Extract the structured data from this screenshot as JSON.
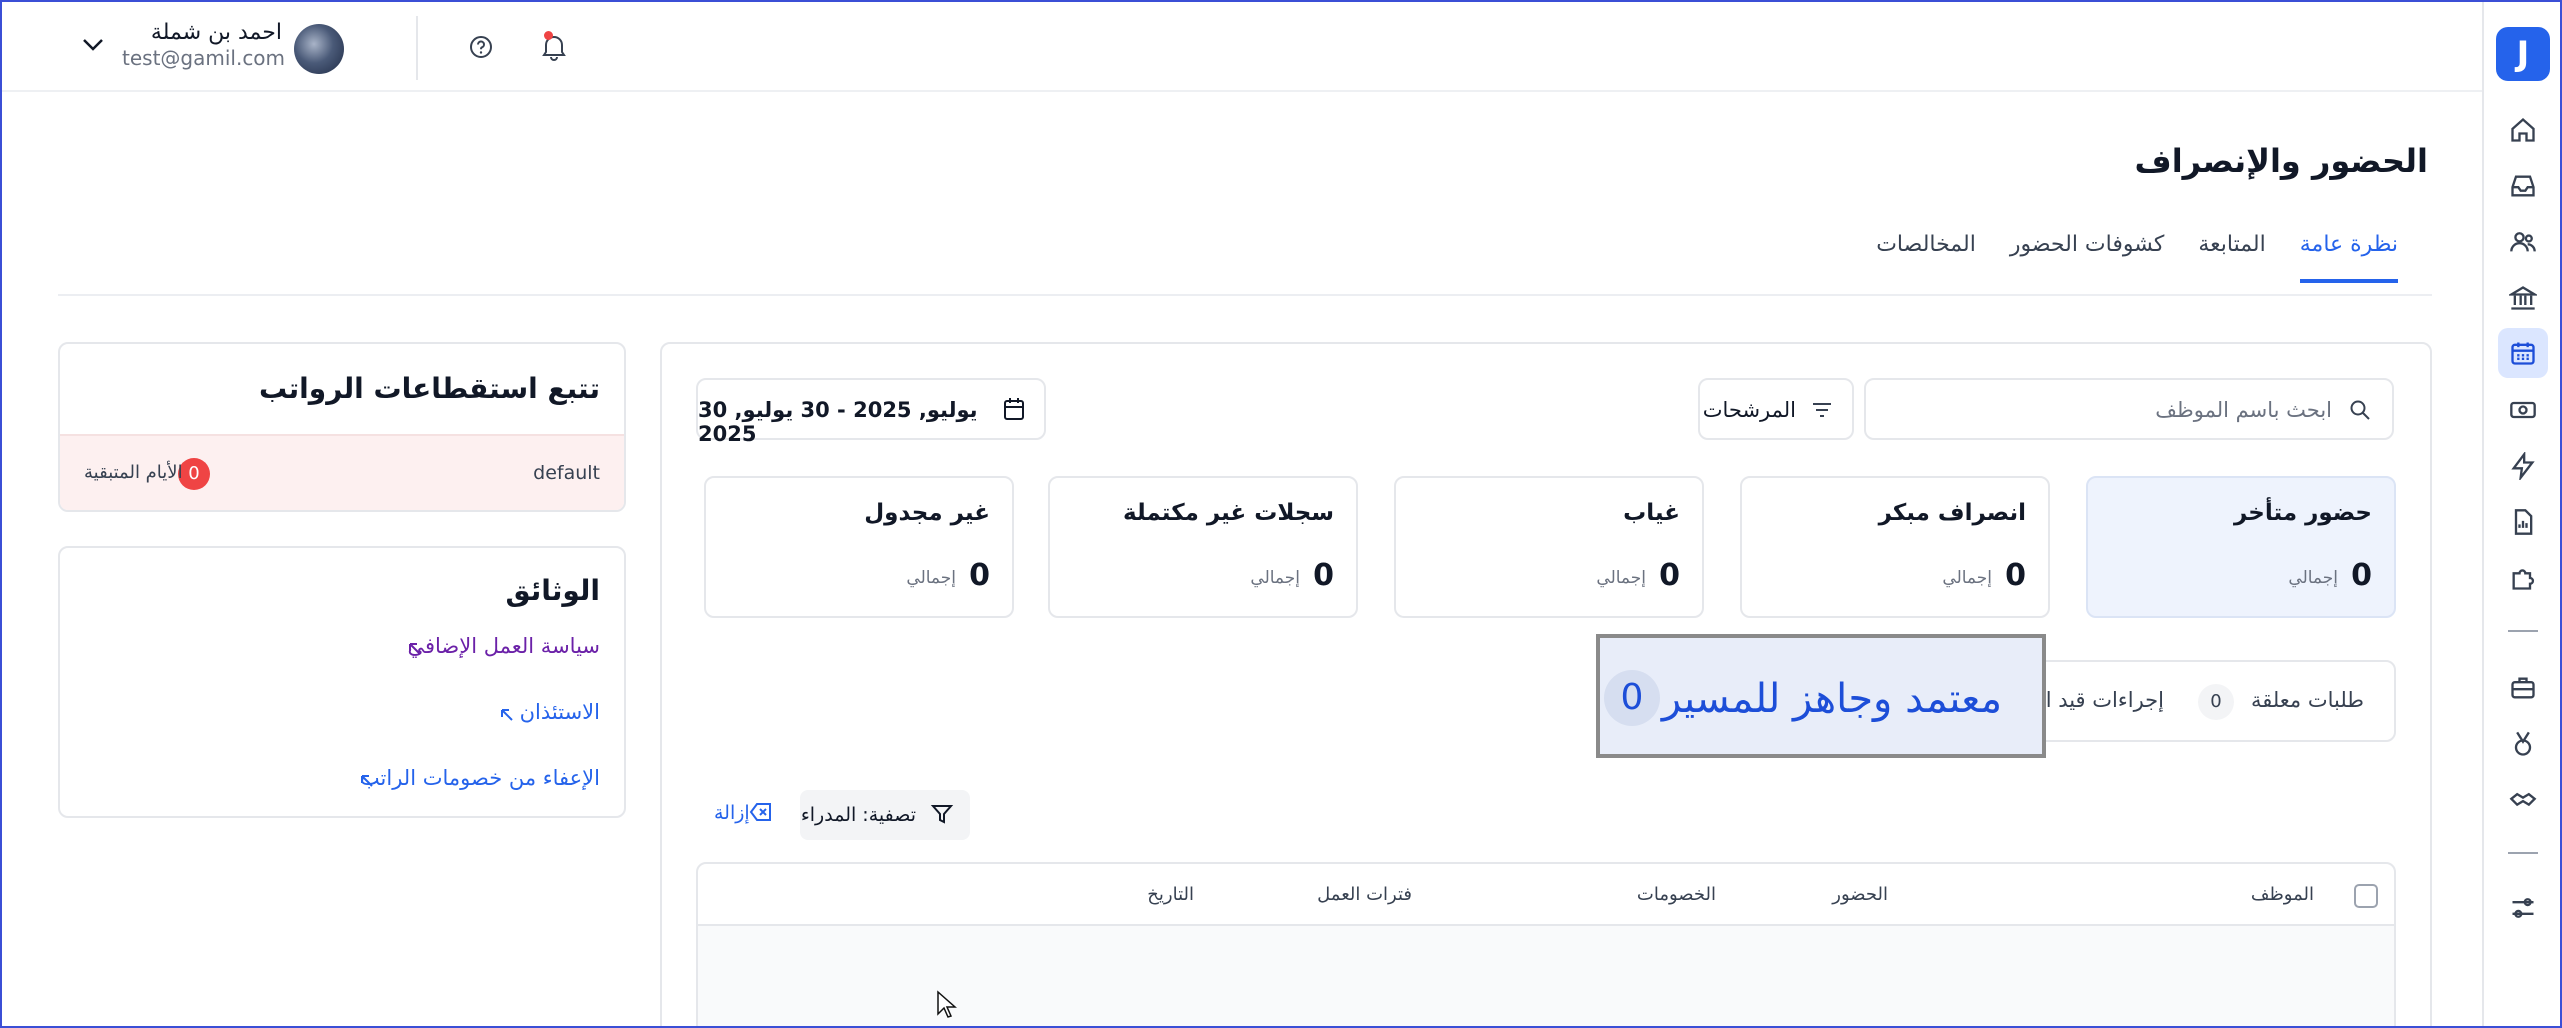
{
  "user": {
    "name": "احمد بن شملة",
    "email": "test@gamil.com"
  },
  "page": {
    "title": "الحضور والإنصراف"
  },
  "tabs": [
    {
      "label": "نظرة عامة",
      "active": true
    },
    {
      "label": "المتابعة"
    },
    {
      "label": "كشوفات الحضور"
    },
    {
      "label": "المخالصات"
    }
  ],
  "toolbar": {
    "search_placeholder": "ابحث باسم الموظف",
    "filters_label": "المرشحات",
    "date_range": "30 يوليو, 2025 - 30 يوليو, 2025"
  },
  "stats": [
    {
      "title": "حضور متأخر",
      "value": "0",
      "unit": "إجمالي"
    },
    {
      "title": "انصراف مبكر",
      "value": "0",
      "unit": "إجمالي"
    },
    {
      "title": "غياب",
      "value": "0",
      "unit": "إجمالي"
    },
    {
      "title": "سجلات غير مكتملة",
      "value": "0",
      "unit": "إجمالي"
    },
    {
      "title": "غير مجدول",
      "value": "0",
      "unit": "إجمالي"
    }
  ],
  "requests": {
    "pending_label": "طلبات معلقة",
    "pending_count": "0",
    "in_progress_label": "إجراءات قيد التن",
    "approved_label": "معتمد وجاهز للمسير",
    "approved_count": "0"
  },
  "filter_chip": {
    "label": "تصفية: المدراء",
    "remove_label": "إزالة"
  },
  "table": {
    "columns": [
      "الموظف",
      "الحضور",
      "الخصومات",
      "فترات العمل",
      "التاريخ"
    ]
  },
  "payroll_card": {
    "title": "تتبع استقطاعات الرواتب",
    "policy": "default",
    "remaining_days_label": "الأيام المتبقية",
    "remaining_days": "0"
  },
  "documents_card": {
    "title": "الوثائق",
    "links": [
      "سياسة العمل الإضافي",
      "الاستئذان",
      "الإعفاء من خصومات الراتب"
    ]
  },
  "sidebar": {
    "logo": "J",
    "icons": [
      "home-icon",
      "inbox-icon",
      "users-icon",
      "bank-icon",
      "calendar-icon",
      "cash-icon",
      "lightning-icon",
      "report-icon",
      "puzzle-icon",
      "briefcase-icon",
      "medal-icon",
      "handshake-icon",
      "settings-sliders-icon"
    ],
    "active": "calendar-icon"
  },
  "colors": {
    "accent": "#2563eb",
    "danger": "#ef4444",
    "highlight_bg": "#eef3fd"
  }
}
